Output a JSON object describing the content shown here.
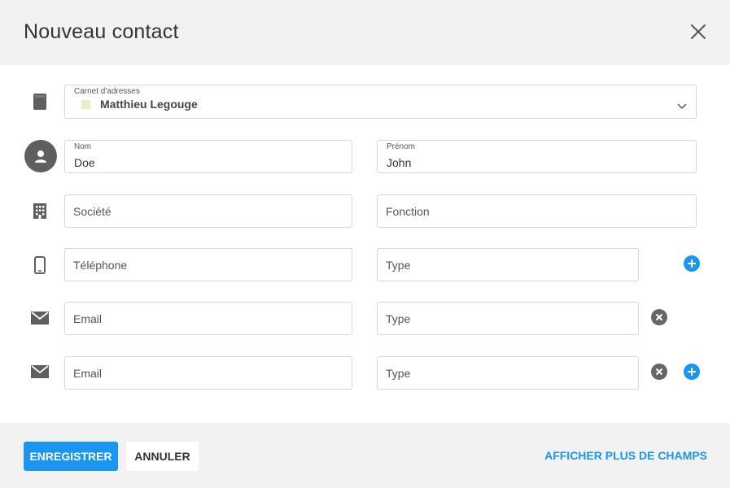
{
  "dialog": {
    "title": "Nouveau contact"
  },
  "address_book": {
    "label": "Carnet d'adresses",
    "value": "Matthieu Legouge",
    "swatch_color": "#e6efc5"
  },
  "name": {
    "last_label": "Nom",
    "last_value": "Doe",
    "first_label": "Prénom",
    "first_value": "John"
  },
  "company": {
    "company_placeholder": "Société",
    "function_placeholder": "Fonction"
  },
  "phone": {
    "placeholder": "Téléphone",
    "type_placeholder": "Type"
  },
  "emails": [
    {
      "placeholder": "Email",
      "type_placeholder": "Type"
    },
    {
      "placeholder": "Email",
      "type_placeholder": "Type"
    }
  ],
  "footer": {
    "save_label": "ENREGISTRER",
    "cancel_label": "ANNULER",
    "more_fields_label": "AFFICHER PLUS DE CHAMPS"
  },
  "colors": {
    "accent": "#1a96f0",
    "header_bg": "#f2f2f2",
    "icon_grey": "#5f5f5f"
  },
  "icons": {
    "close": "close-icon",
    "address_book": "book-icon",
    "contact": "person-icon",
    "company": "building-icon",
    "phone": "mobile-phone-icon",
    "email": "envelope-icon",
    "remove": "remove-circle-icon",
    "add": "add-circle-icon",
    "dropdown": "chevron-down-icon"
  }
}
